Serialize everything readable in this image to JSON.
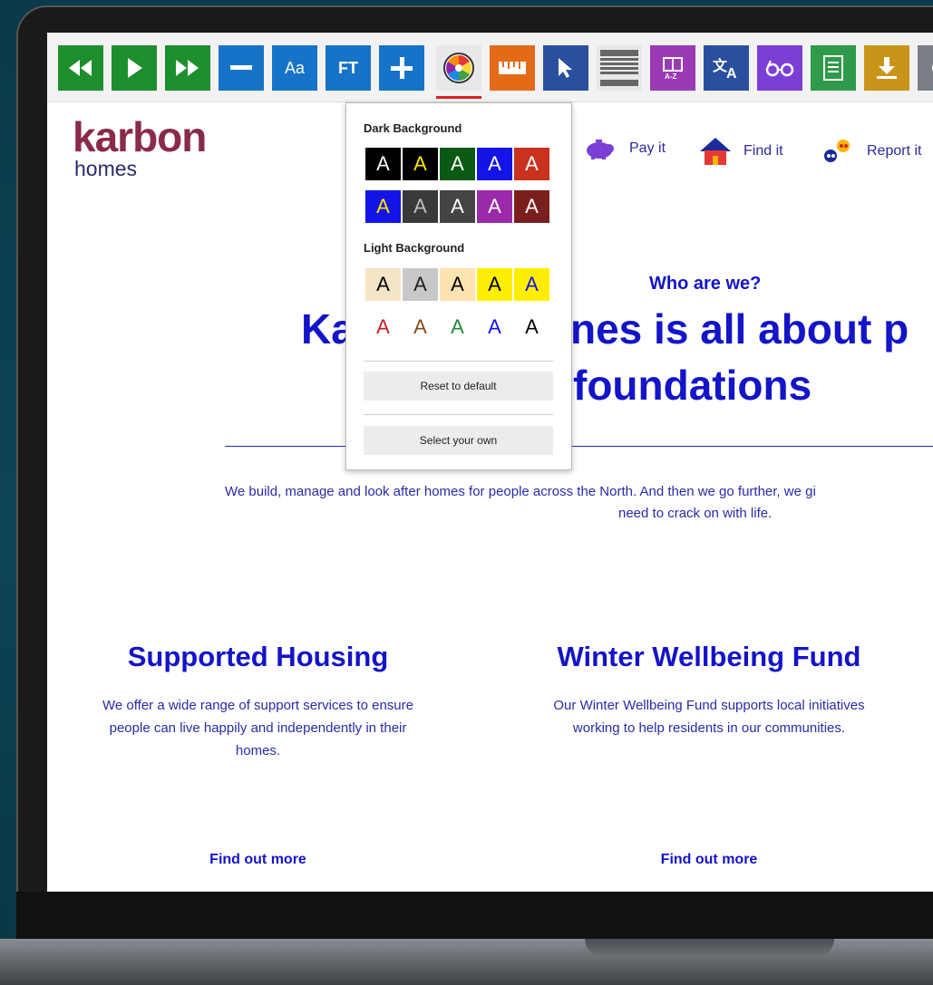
{
  "toolbar": {
    "buttons": [
      {
        "icon": "rewind-icon",
        "label": "◀◀",
        "color": "#1e8f2e"
      },
      {
        "icon": "play-icon",
        "label": "▶",
        "color": "#1e8f2e"
      },
      {
        "icon": "fast-forward-icon",
        "label": "▶▶",
        "color": "#1e8f2e"
      },
      {
        "icon": "minus-icon",
        "label": "—",
        "color": "#1773c8"
      },
      {
        "icon": "text-size-icon",
        "label": "Aa",
        "color": "#1773c8"
      },
      {
        "icon": "font-type-icon",
        "label": "FT",
        "color": "#1773c8"
      },
      {
        "icon": "plus-icon",
        "label": "+",
        "color": "#1773c8"
      },
      {
        "icon": "color-wheel-icon",
        "label": "",
        "color": "#e8e8e8"
      },
      {
        "icon": "ruler-icon",
        "label": "",
        "color": "#e36a16"
      },
      {
        "icon": "cursor-icon",
        "label": "",
        "color": "#2a4f9e"
      },
      {
        "icon": "screen-mask-icon",
        "label": "",
        "color": "#e8e8e8"
      },
      {
        "icon": "dictionary-icon",
        "label": "",
        "color": "#9b3ab5"
      },
      {
        "icon": "translate-icon",
        "label": "",
        "color": "#2a4f9e"
      },
      {
        "icon": "reading-glasses-icon",
        "label": "",
        "color": "#7b3fd6"
      },
      {
        "icon": "text-file-icon",
        "label": "",
        "color": "#2e9a4a"
      },
      {
        "icon": "download-icon",
        "label": "",
        "color": "#c9941a"
      },
      {
        "icon": "more-icon",
        "label": "",
        "color": "#7a7f86"
      }
    ]
  },
  "header": {
    "logo_main": "karbon",
    "logo_sub": "homes",
    "nav": [
      {
        "label": "Pay it",
        "icon": "piggy-bank-icon"
      },
      {
        "label": "Find it",
        "icon": "house-icon"
      },
      {
        "label": "Report it",
        "icon": "report-icon"
      }
    ]
  },
  "hero": {
    "kicker": "Who are we?",
    "headline_left": "Ka",
    "headline_right": "nes is all about p",
    "headline_line2": "foundations",
    "intro_line1": "We build, manage and look after homes for people across the North. And then we go further, we gi",
    "intro_line2": "need to crack on with life."
  },
  "cards": [
    {
      "title": "Supported Housing",
      "body": "We offer a wide range of support services to ensure people can live happily and independently in their homes.",
      "link": "Find out more"
    },
    {
      "title": "Winter Wellbeing Fund",
      "body": "Our Winter Wellbeing Fund supports local initiatives working to help residents in our communities.",
      "link": "Find out more"
    }
  ],
  "color_popup": {
    "dark_label": "Dark Background",
    "light_label": "Light Background",
    "swatch_letter": "A",
    "dark_rows": [
      [
        {
          "bg": "#000000",
          "fg": "#ffffff"
        },
        {
          "bg": "#000000",
          "fg": "#ffe400"
        },
        {
          "bg": "#0a5a14",
          "fg": "#ffffff"
        },
        {
          "bg": "#1414e6",
          "fg": "#ffffff"
        },
        {
          "bg": "#c8321e",
          "fg": "#ffffff"
        }
      ],
      [
        {
          "bg": "#1414e6",
          "fg": "#ffe400"
        },
        {
          "bg": "#3a3a3a",
          "fg": "#bdbdbd"
        },
        {
          "bg": "#444444",
          "fg": "#ffffff"
        },
        {
          "bg": "#9b2aa8",
          "fg": "#ffffff"
        },
        {
          "bg": "#7a1e1e",
          "fg": "#ffffff"
        }
      ]
    ],
    "light_rows": [
      [
        {
          "bg": "#f6e4c8",
          "fg": "#000000"
        },
        {
          "bg": "#c8c8c8",
          "fg": "#222222"
        },
        {
          "bg": "#fde3b0",
          "fg": "#000000"
        },
        {
          "bg": "#ffee00",
          "fg": "#000000"
        },
        {
          "bg": "#ffee00",
          "fg": "#1414e6"
        }
      ],
      [
        {
          "bg": "#ffffff",
          "fg": "#c81e1e"
        },
        {
          "bg": "#ffffff",
          "fg": "#8a4a1a"
        },
        {
          "bg": "#ffffff",
          "fg": "#1e8a3a"
        },
        {
          "bg": "#ffffff",
          "fg": "#1414e6"
        },
        {
          "bg": "#ffffff",
          "fg": "#000000"
        }
      ]
    ],
    "reset_label": "Reset to default",
    "select_label": "Select your own"
  }
}
